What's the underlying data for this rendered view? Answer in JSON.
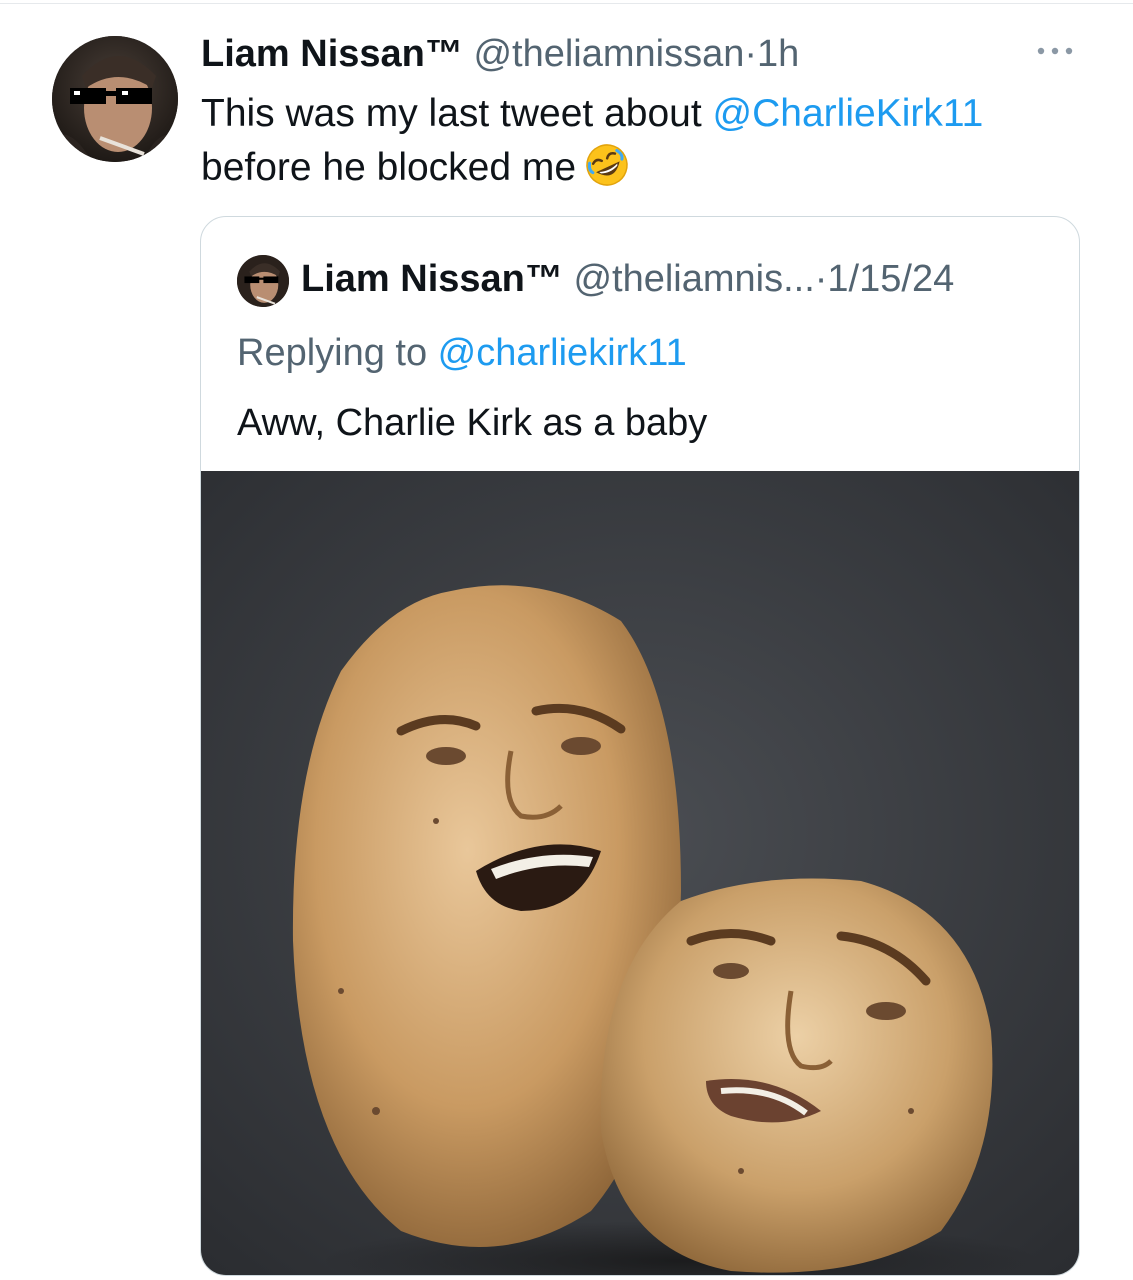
{
  "tweet": {
    "author_name": "Liam Nissan™",
    "author_handle": "@theliamnissan",
    "separator": "·",
    "timestamp": "1h",
    "text_before": "This was my last tweet about ",
    "mention": "@CharlieKirk11",
    "text_after": " before he blocked me",
    "emoji_icon": "rolling-on-floor-laughing-emoji",
    "more_icon": "more-horizontal-icon"
  },
  "quoted_tweet": {
    "author_name": "Liam Nissan™",
    "author_handle": "@theliamnis...",
    "separator": "·",
    "timestamp": "1/15/24",
    "replying_label": "Replying to ",
    "replying_handle": "@charliekirk11",
    "text": "Aww, Charlie Kirk as a baby"
  },
  "colors": {
    "link": "#1d9bf0",
    "secondary_text": "#536471",
    "border": "#cfd9de"
  }
}
